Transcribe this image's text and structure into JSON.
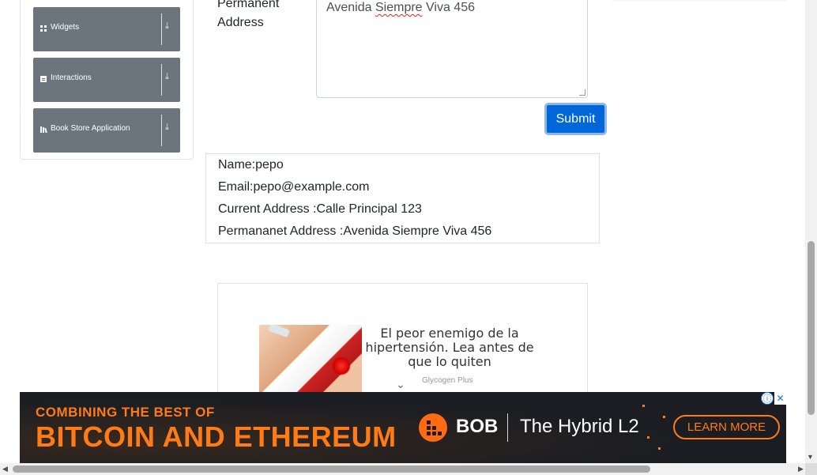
{
  "sidebar": {
    "groups": [
      {
        "label": "Widgets",
        "icon": "grid-icon",
        "arrow": "⤓"
      },
      {
        "label": "Interactions",
        "icon": "square-icon",
        "arrow": "⤓"
      },
      {
        "label": "Book Store Application",
        "icon": "books-icon",
        "arrow": "⤓"
      }
    ]
  },
  "form": {
    "permanent_address_label": "Permanent Address",
    "permanent_address_value_pre": "Avenida ",
    "permanent_address_value_misspelled": "Siempre",
    "permanent_address_value_post": " Viva 456",
    "submit_label": "Submit"
  },
  "output": {
    "name": "Name:pepo",
    "email": "Email:pepo@example.com",
    "current_address": "Current Address :Calle Principal 123",
    "permanent_address": "Permananet Address :Avenida Siempre Viva 456"
  },
  "ad": {
    "headline": "El peor enemigo de la hipertensión. Lea antes de que lo quiten",
    "source": "Glycogen Plus",
    "chevron": "⌄"
  },
  "banner": {
    "headline_small": "COMBINING THE BEST OF",
    "headline_large": "BITCOIN AND ETHEREUM",
    "brand": "BOB",
    "tagline": "The Hybrid L2",
    "cta": "LEARN MORE",
    "info_icon": "ⓘ",
    "close_icon": "✕",
    "accent_color": "#ff7b16"
  },
  "scrollbars": {
    "down_arrow": "▼",
    "left_arrow": "◀",
    "right_arrow": "▶"
  }
}
